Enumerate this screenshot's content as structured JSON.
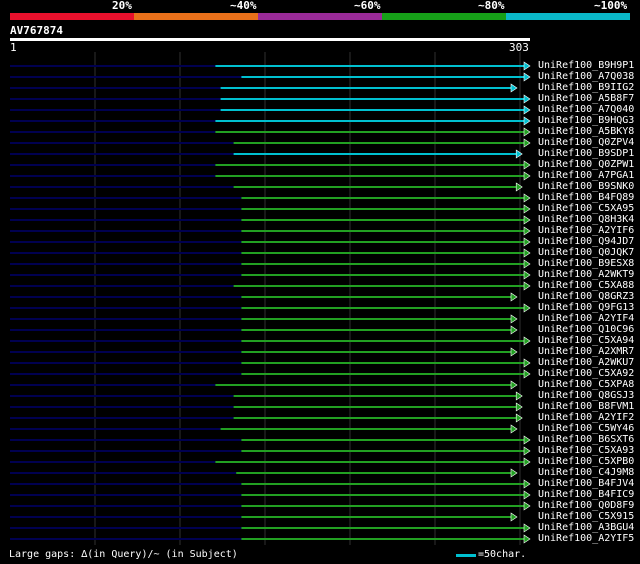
{
  "legend": {
    "segments": [
      {
        "color": "#e8102c"
      },
      {
        "color": "#e8701a"
      },
      {
        "color": "#9a2a98"
      },
      {
        "color": "#16a018"
      },
      {
        "color": "#0ab8c8"
      }
    ],
    "labels": [
      "20%",
      "~40%",
      "~60%",
      "~80%",
      "~100%"
    ]
  },
  "query": {
    "name": "AV767874",
    "start": "1",
    "end": "303"
  },
  "colors": {
    "cyan": "#00c0d0",
    "green": "#22a022",
    "navy": "#000050",
    "grid": "#303030"
  },
  "hits": [
    {
      "name": "UniRef100_B9H9P1",
      "start": 0.395,
      "color": "cyan"
    },
    {
      "name": "UniRef100_A7Q038",
      "start": 0.445,
      "color": "cyan"
    },
    {
      "name": "UniRef100_B9IIG2",
      "start": 0.405,
      "color": "cyan",
      "end": 0.975
    },
    {
      "name": "UniRef100_A5B8F7",
      "start": 0.405,
      "color": "cyan"
    },
    {
      "name": "UniRef100_A7Q040",
      "start": 0.405,
      "color": "cyan"
    },
    {
      "name": "UniRef100_B9HQG3",
      "start": 0.395,
      "color": "cyan"
    },
    {
      "name": "UniRef100_A5BKY8",
      "start": 0.395,
      "color": "green"
    },
    {
      "name": "UniRef100_Q0ZPV4",
      "start": 0.43,
      "color": "green"
    },
    {
      "name": "UniRef100_B9SDP1",
      "start": 0.43,
      "color": "cyan",
      "end": 0.985
    },
    {
      "name": "UniRef100_Q0ZPW1",
      "start": 0.395,
      "color": "green"
    },
    {
      "name": "UniRef100_A7PGA1",
      "start": 0.395,
      "color": "green"
    },
    {
      "name": "UniRef100_B9SNK0",
      "start": 0.43,
      "color": "green",
      "end": 0.985
    },
    {
      "name": "UniRef100_B4FQ89",
      "start": 0.445,
      "color": "green"
    },
    {
      "name": "UniRef100_C5XA95",
      "start": 0.445,
      "color": "green"
    },
    {
      "name": "UniRef100_Q8H3K4",
      "start": 0.445,
      "color": "green"
    },
    {
      "name": "UniRef100_A2YIF6",
      "start": 0.445,
      "color": "green"
    },
    {
      "name": "UniRef100_Q94JD7",
      "start": 0.445,
      "color": "green"
    },
    {
      "name": "UniRef100_Q0JQK7",
      "start": 0.445,
      "color": "green"
    },
    {
      "name": "UniRef100_B9ESX8",
      "start": 0.445,
      "color": "green"
    },
    {
      "name": "UniRef100_A2WKT9",
      "start": 0.445,
      "color": "green"
    },
    {
      "name": "UniRef100_C5XA88",
      "start": 0.43,
      "color": "green"
    },
    {
      "name": "UniRef100_Q8GRZ3",
      "start": 0.445,
      "color": "green",
      "end": 0.975
    },
    {
      "name": "UniRef100_Q9FG13",
      "start": 0.445,
      "color": "green"
    },
    {
      "name": "UniRef100_A2YIF4",
      "start": 0.445,
      "color": "green",
      "end": 0.975
    },
    {
      "name": "UniRef100_Q10C96",
      "start": 0.445,
      "color": "green",
      "end": 0.975
    },
    {
      "name": "UniRef100_C5XA94",
      "start": 0.445,
      "color": "green"
    },
    {
      "name": "UniRef100_A2XMR7",
      "start": 0.445,
      "color": "green",
      "end": 0.975
    },
    {
      "name": "UniRef100_A2WKU7",
      "start": 0.445,
      "color": "green"
    },
    {
      "name": "UniRef100_C5XA92",
      "start": 0.445,
      "color": "green"
    },
    {
      "name": "UniRef100_C5XPA8",
      "start": 0.395,
      "color": "green",
      "end": 0.975
    },
    {
      "name": "UniRef100_Q8GSJ3",
      "start": 0.43,
      "color": "green",
      "end": 0.985
    },
    {
      "name": "UniRef100_B8FVM1",
      "start": 0.43,
      "color": "green",
      "end": 0.985
    },
    {
      "name": "UniRef100_A2YIF2",
      "start": 0.43,
      "color": "green",
      "end": 0.985
    },
    {
      "name": "UniRef100_C5WY46",
      "start": 0.405,
      "color": "green",
      "end": 0.975
    },
    {
      "name": "UniRef100_B6SXT6",
      "start": 0.445,
      "color": "green"
    },
    {
      "name": "UniRef100_C5XA93",
      "start": 0.445,
      "color": "green"
    },
    {
      "name": "UniRef100_C5XPB0",
      "start": 0.395,
      "color": "green"
    },
    {
      "name": "UniRef100_C4J9M8",
      "start": 0.435,
      "color": "green",
      "end": 0.975
    },
    {
      "name": "UniRef100_B4FJV4",
      "start": 0.445,
      "color": "green"
    },
    {
      "name": "UniRef100_B4FIC9",
      "start": 0.445,
      "color": "green"
    },
    {
      "name": "UniRef100_Q0D8F9",
      "start": 0.445,
      "color": "green"
    },
    {
      "name": "UniRef100_C5X915",
      "start": 0.445,
      "color": "green",
      "end": 0.975
    },
    {
      "name": "UniRef100_A3BGU4",
      "start": 0.445,
      "color": "green"
    },
    {
      "name": "UniRef100_A2YIF5",
      "start": 0.445,
      "color": "green"
    }
  ],
  "footer": {
    "gaps": "Large gaps: ∆(in Query)/~ (in Subject)",
    "scale": "=50char."
  }
}
